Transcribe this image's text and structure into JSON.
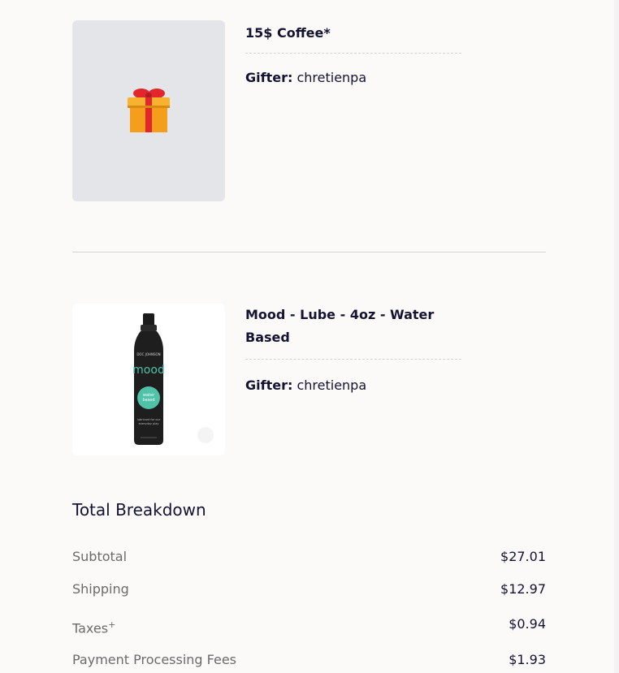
{
  "items": [
    {
      "title": "15$ Coffee*",
      "gifter_label": "Gifter:",
      "gifter_name": "chretienpa",
      "image_icon": "gift-box-icon"
    },
    {
      "title": "Mood - Lube - 4oz - Water Based",
      "gifter_label": "Gifter:",
      "gifter_name": "chretienpa",
      "image_icon": "product-bottle-image",
      "bottle_brand": "mood",
      "bottle_badge_line1": "water",
      "bottle_badge_line2": "based",
      "bottle_caption_line1": "lubricant for our",
      "bottle_caption_line2": "everyday play"
    }
  ],
  "breakdown": {
    "title": "Total Breakdown",
    "rows": [
      {
        "label": "Subtotal",
        "value": "$27.01"
      },
      {
        "label": "Shipping",
        "value": "$12.97"
      },
      {
        "label": "Taxes",
        "label_suffix": "+",
        "value": "$0.94"
      },
      {
        "label": "Payment Processing Fees",
        "value": "$1.93"
      }
    ]
  },
  "colors": {
    "background": "#fbfaf8",
    "text": "#141432",
    "muted": "#6b6b6b",
    "bottle_accent": "#4fc2a8"
  }
}
